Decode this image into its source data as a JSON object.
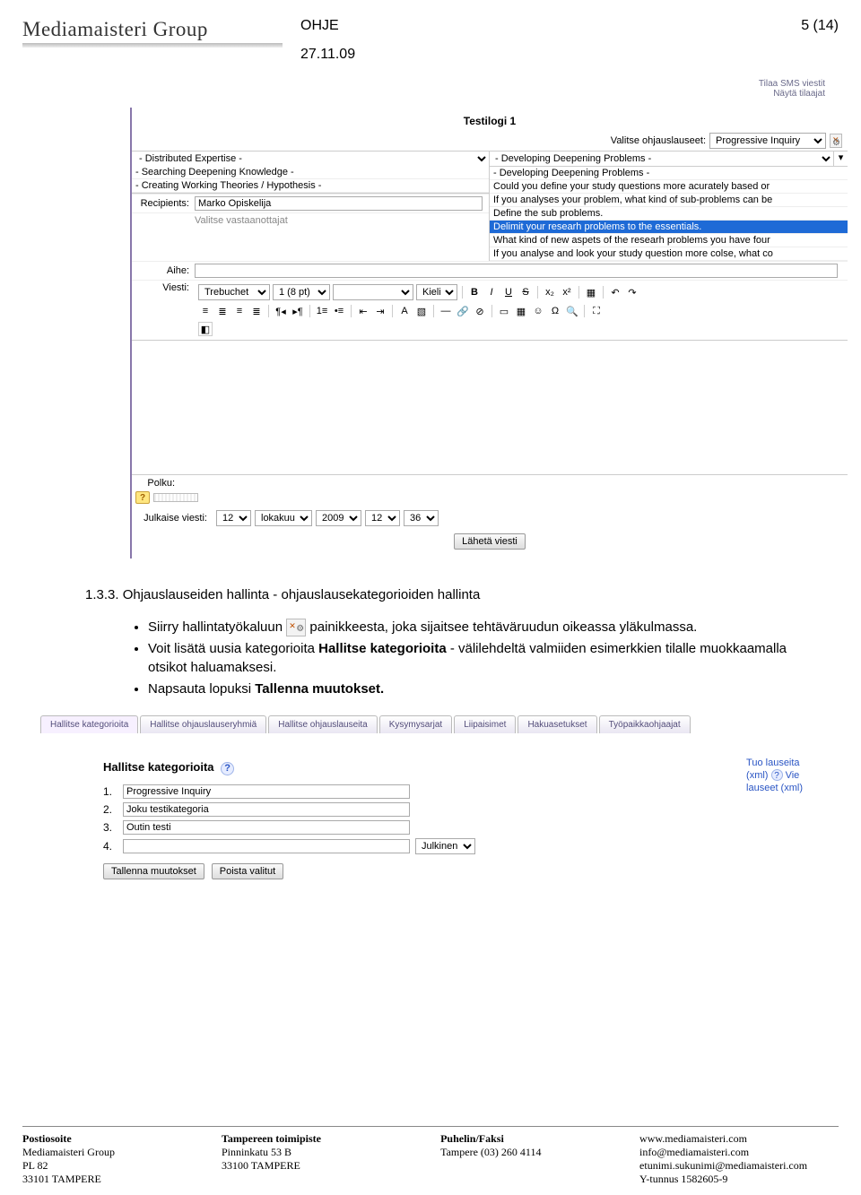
{
  "header": {
    "logo": "Mediamaisteri Group",
    "doc_type": "OHJE",
    "page": "5 (14)",
    "date": "27.11.09"
  },
  "app": {
    "title": "Testilogi 1",
    "toplinks": {
      "sms": "Tilaa SMS viestit",
      "show": "Näytä tilaajat"
    },
    "valitse_label": "Valitse ohjauslauseet:",
    "valitse_value": "Progressive Inquiry",
    "left_opts": [
      "- Distributed Expertise -",
      "- Searching Deepening Knowledge -",
      "- Creating Working Theories / Hypothesis -"
    ],
    "right_header": "- Developing Deepening Problems -",
    "right_opts": [
      "- Developing Deepening Problems -",
      "Could you define your study questions more acurately based or",
      "If you analyses your problem, what kind of sub-problems can be",
      "Define the sub problems.",
      "Delimit your researh problems to the essentials.",
      "What kind of new aspets of the researh problems you have four",
      "If you analyse and look your study question more colse, what co"
    ],
    "right_highlight_index": 4,
    "labels": {
      "recipients": "Recipients:",
      "aihe": "Aihe:",
      "viesti": "Viesti:",
      "polku": "Polku:",
      "julkaise": "Julkaise viesti:"
    },
    "recipients": [
      "Marko Opiskelija",
      "Valitse vastaanottajat"
    ],
    "toolbar": {
      "font": "Trebuchet",
      "size": "1 (8 pt)",
      "style_sel": "",
      "lang": "Kieli"
    },
    "date_sel": {
      "d": "12",
      "m": "lokakuu",
      "y": "2009",
      "h": "12",
      "min": "36"
    },
    "send_btn": "Lähetä viesti"
  },
  "doc": {
    "heading": "1.3.3. Ohjauslauseiden hallinta - ohjauslausekategorioiden hallinta",
    "b1a": "Siirry hallintatyökaluun ",
    "b1b": " painikkeesta, joka sijaitsee tehtäväruudun oikeassa yläkulmassa.",
    "b2": "Voit lisätä uusia kategorioita Hallitse kategorioita - välilehdeltä valmiiden esimerkkien tilalle muokkaamalla otsikot haluamaksesi.",
    "b2_bold": "Hallitse kategorioita",
    "b3": "Napsauta lopuksi Tallenna muutokset.",
    "b3_bold": "Tallenna muutokset."
  },
  "tabs": [
    "Hallitse kategorioita",
    "Hallitse ohjauslauseryhmiä",
    "Hallitse ohjauslauseita",
    "Kysymysarjat",
    "Liipaisimet",
    "Hakuasetukset",
    "Työpaikkaohjaajat"
  ],
  "cat": {
    "title": "Hallitse kategorioita",
    "rows": [
      {
        "n": "1.",
        "v": "Progressive Inquiry"
      },
      {
        "n": "2.",
        "v": "Joku testikategoria"
      },
      {
        "n": "3.",
        "v": "Outin testi"
      },
      {
        "n": "4.",
        "v": ""
      }
    ],
    "julkinen": "Julkinen",
    "side": {
      "l1": "Tuo lauseita",
      "l2": "(xml)",
      "l3": "Vie",
      "l4": "lauseet (xml)"
    },
    "btn_save": "Tallenna muutokset",
    "btn_del": "Poista valitut"
  },
  "footer": {
    "c1": [
      "Postiosoite",
      "Mediamaisteri Group",
      "PL 82",
      "33101 TAMPERE"
    ],
    "c2": [
      "Tampereen toimipiste",
      "Pinninkatu  53 B",
      "33100 TAMPERE"
    ],
    "c3": [
      "Puhelin/Faksi",
      "Tampere (03) 260 4114"
    ],
    "c4": [
      "www.mediamaisteri.com",
      "info@mediamaisteri.com",
      "etunimi.sukunimi@mediamaisteri.com",
      "Y-tunnus 1582605-9"
    ]
  }
}
